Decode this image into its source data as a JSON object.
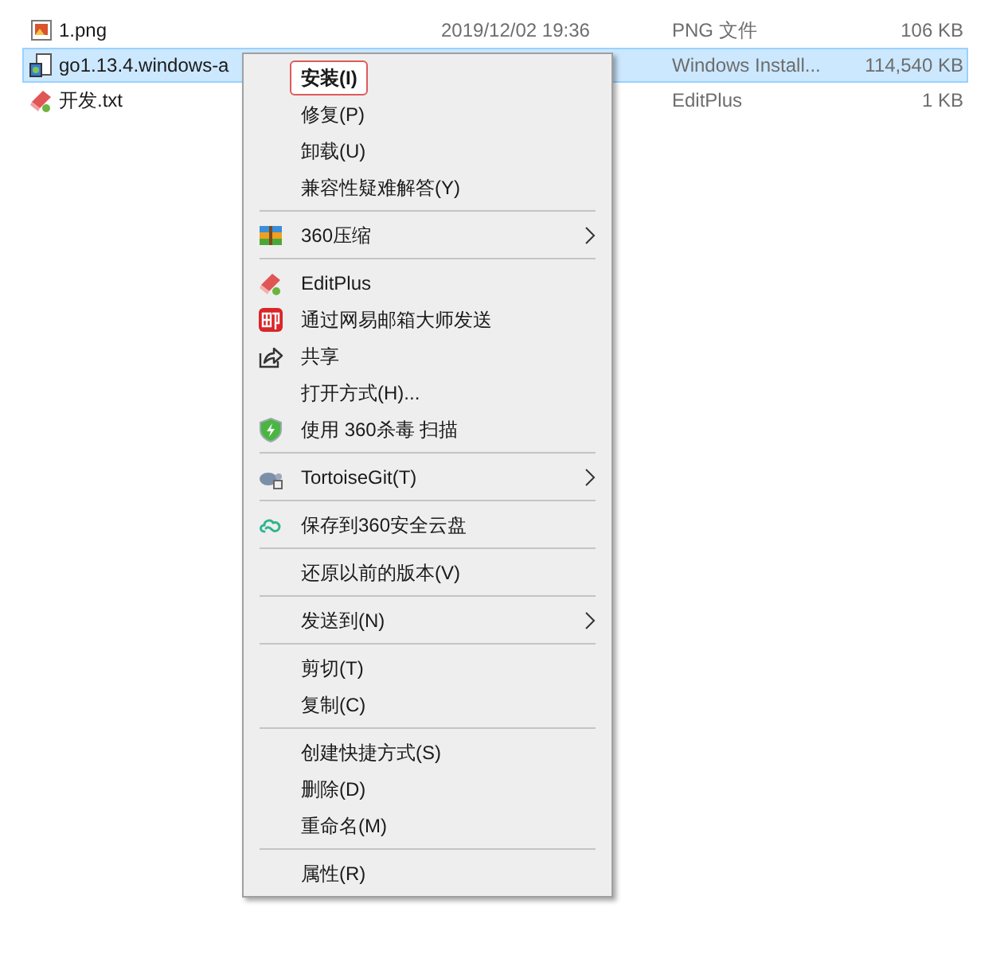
{
  "files": [
    {
      "name": "1.png",
      "date": "2019/12/02 19:36",
      "type": "PNG 文件",
      "size": "106 KB",
      "selected": false
    },
    {
      "name": "go1.13.4.windows-a",
      "type": "Windows Install...",
      "size": "114,540 KB",
      "selected": true
    },
    {
      "name": "开发.txt",
      "type": "EditPlus",
      "size": "1 KB",
      "selected": false
    }
  ],
  "context_menu": [
    {
      "kind": "item",
      "label": "安装(I)",
      "default": true,
      "outlined": true
    },
    {
      "kind": "item",
      "label": "修复(P)"
    },
    {
      "kind": "item",
      "label": "卸载(U)"
    },
    {
      "kind": "item",
      "label": "兼容性疑难解答(Y)"
    },
    {
      "kind": "separator"
    },
    {
      "kind": "item",
      "label": "360压缩",
      "submenu": true
    },
    {
      "kind": "separator"
    },
    {
      "kind": "item",
      "label": "EditPlus"
    },
    {
      "kind": "item",
      "label": "通过网易邮箱大师发送"
    },
    {
      "kind": "item",
      "label": "共享"
    },
    {
      "kind": "item",
      "label": "打开方式(H)..."
    },
    {
      "kind": "item",
      "label": "使用 360杀毒 扫描"
    },
    {
      "kind": "separator"
    },
    {
      "kind": "item",
      "label": "TortoiseGit(T)",
      "submenu": true
    },
    {
      "kind": "separator"
    },
    {
      "kind": "item",
      "label": "保存到360安全云盘"
    },
    {
      "kind": "separator"
    },
    {
      "kind": "item",
      "label": "还原以前的版本(V)"
    },
    {
      "kind": "separator"
    },
    {
      "kind": "item",
      "label": "发送到(N)",
      "submenu": true
    },
    {
      "kind": "separator"
    },
    {
      "kind": "item",
      "label": "剪切(T)"
    },
    {
      "kind": "item",
      "label": "复制(C)"
    },
    {
      "kind": "separator"
    },
    {
      "kind": "item",
      "label": "创建快捷方式(S)"
    },
    {
      "kind": "item",
      "label": "删除(D)"
    },
    {
      "kind": "item",
      "label": "重命名(M)"
    },
    {
      "kind": "separator"
    },
    {
      "kind": "item",
      "label": "属性(R)"
    }
  ]
}
